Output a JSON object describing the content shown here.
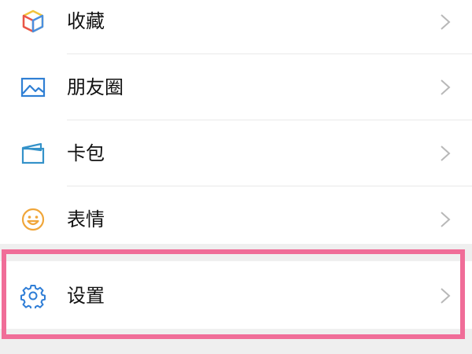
{
  "menu": {
    "items": [
      {
        "label": "收藏",
        "icon": "favorites-cube-icon"
      },
      {
        "label": "朋友圈",
        "icon": "moments-picture-icon"
      },
      {
        "label": "卡包",
        "icon": "card-wallet-icon"
      },
      {
        "label": "表情",
        "icon": "smiley-icon"
      },
      {
        "label": "设置",
        "icon": "gear-icon"
      }
    ],
    "chevron_icon": "chevron-right-icon"
  },
  "colors": {
    "highlight_border": "#f06d98",
    "section_gap": "#efefef",
    "divider": "#e9e9e9",
    "chevron": "#b8b8b8",
    "cube_yellow": "#f3c43c",
    "cube_red": "#e9544a",
    "cube_blue": "#4a8fe0",
    "moments_blue": "#2f7fd4",
    "card_blue": "#3492c9",
    "smiley_orange": "#f0a63a",
    "gear_blue": "#2e7dd6"
  }
}
